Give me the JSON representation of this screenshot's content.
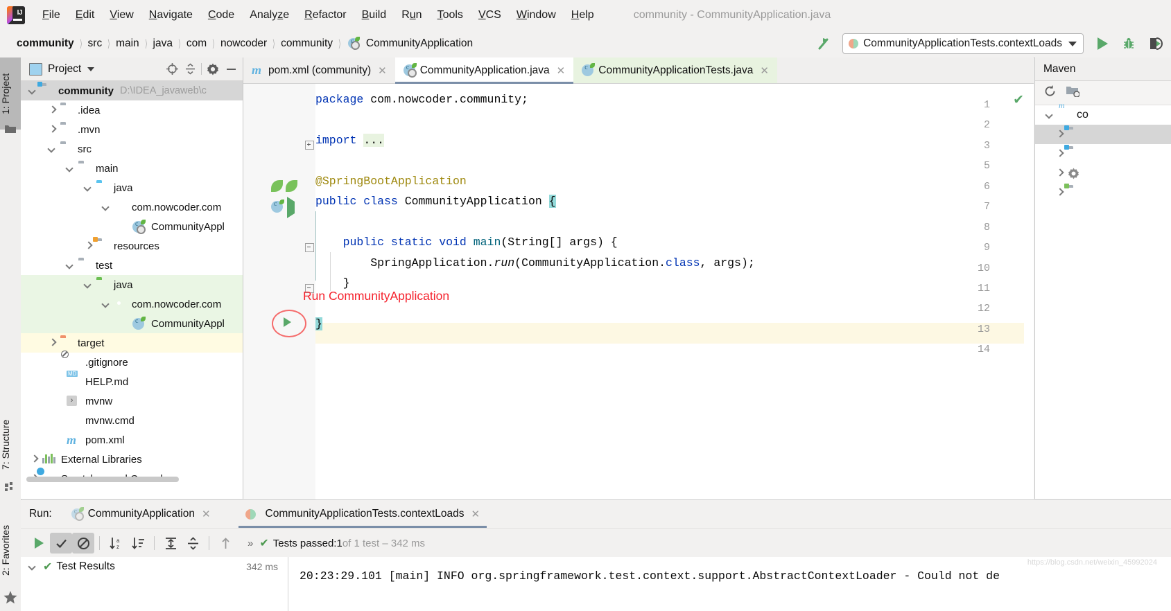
{
  "window": {
    "title": "community - CommunityApplication.java",
    "logo_icon": "intellij-idea-logo"
  },
  "menubar": {
    "items": [
      {
        "label": "File",
        "mnemonic": "F"
      },
      {
        "label": "Edit",
        "mnemonic": "E"
      },
      {
        "label": "View",
        "mnemonic": "V"
      },
      {
        "label": "Navigate",
        "mnemonic": "N"
      },
      {
        "label": "Code",
        "mnemonic": "C"
      },
      {
        "label": "Analyze",
        "mnemonic": "z"
      },
      {
        "label": "Refactor",
        "mnemonic": "R"
      },
      {
        "label": "Build",
        "mnemonic": "B"
      },
      {
        "label": "Run",
        "mnemonic": "R"
      },
      {
        "label": "Tools",
        "mnemonic": "T"
      },
      {
        "label": "VCS",
        "mnemonic": "V"
      },
      {
        "label": "Window",
        "mnemonic": "W"
      },
      {
        "label": "Help",
        "mnemonic": "H"
      }
    ]
  },
  "navbar": {
    "breadcrumbs": [
      {
        "label": "community",
        "bold": true
      },
      {
        "label": "src",
        "bold": false
      },
      {
        "label": "main",
        "bold": false
      },
      {
        "label": "java",
        "bold": false
      },
      {
        "label": "com",
        "bold": false
      },
      {
        "label": "nowcoder",
        "bold": false
      },
      {
        "label": "community",
        "bold": false
      },
      {
        "label": "CommunityApplication",
        "bold": false,
        "icon": "spring-class-icon"
      }
    ],
    "hammer_icon": "build-hammer-icon",
    "run_config": {
      "label": "CommunityApplicationTests.contextLoads",
      "icon": "junit-run-config-icon"
    },
    "buttons": [
      {
        "name": "run-button",
        "icon": "play-icon"
      },
      {
        "name": "debug-button",
        "icon": "bug-icon"
      },
      {
        "name": "run-with-coverage-button",
        "icon": "coverage-icon"
      }
    ]
  },
  "left_rail": {
    "tabs": [
      {
        "label": "1: Project",
        "number": "1",
        "text": ": Project",
        "icon": "project-folder-icon",
        "active": true
      },
      {
        "label": "7: Structure",
        "number": "7",
        "text": ": Structure",
        "icon": "structure-icon",
        "active": false
      },
      {
        "label": "2: Favorites",
        "number": "2",
        "text": ": Favorites",
        "icon": "star-icon",
        "active": false
      }
    ]
  },
  "project_panel": {
    "header": {
      "title": "Project",
      "view_icon": "project-view-icon",
      "caret_icon": "chevron-down-icon",
      "tools": [
        {
          "name": "locate-file-button",
          "icon": "crosshair-icon"
        },
        {
          "name": "collapse-all-button",
          "icon": "collapse-all-icon"
        },
        {
          "name": "settings-button",
          "icon": "gear-icon"
        },
        {
          "name": "hide-button",
          "icon": "minimize-icon"
        }
      ]
    },
    "tree": [
      {
        "label": "community",
        "path": "D:\\IDEA_javaweb\\c",
        "indent": 0,
        "arrow": "down",
        "icon": "module-folder-icon",
        "bold": true,
        "highlight": "selected"
      },
      {
        "label": ".idea",
        "indent": 1,
        "arrow": "right",
        "icon": "folder-icon"
      },
      {
        "label": ".mvn",
        "indent": 1,
        "arrow": "right",
        "icon": "folder-icon"
      },
      {
        "label": "src",
        "indent": 1,
        "arrow": "down",
        "icon": "folder-icon"
      },
      {
        "label": "main",
        "indent": 2,
        "arrow": "down",
        "icon": "folder-icon"
      },
      {
        "label": "java",
        "indent": 3,
        "arrow": "down",
        "icon": "source-folder-blue-icon"
      },
      {
        "label": "com.nowcoder.com",
        "indent": 4,
        "arrow": "down",
        "icon": "package-icon"
      },
      {
        "label": "CommunityAppl",
        "indent": 5,
        "arrow": "none",
        "icon": "spring-boot-class-icon"
      },
      {
        "label": "resources",
        "indent": 3,
        "arrow": "right",
        "icon": "resources-folder-icon"
      },
      {
        "label": "test",
        "indent": 2,
        "arrow": "down",
        "icon": "folder-icon"
      },
      {
        "label": "java",
        "indent": 3,
        "arrow": "down",
        "icon": "test-source-folder-green-icon",
        "highlight": "green"
      },
      {
        "label": "com.nowcoder.com",
        "indent": 4,
        "arrow": "down",
        "icon": "package-icon",
        "highlight": "green"
      },
      {
        "label": "CommunityAppl",
        "indent": 5,
        "arrow": "none",
        "icon": "test-class-icon",
        "highlight": "green"
      },
      {
        "label": "target",
        "indent": 1,
        "arrow": "right",
        "icon": "excluded-folder-orange-icon",
        "highlight": "yellow"
      },
      {
        "label": ".gitignore",
        "indent": 2,
        "arrow": "none",
        "icon": "gitignore-file-icon"
      },
      {
        "label": "HELP.md",
        "indent": 2,
        "arrow": "none",
        "icon": "markdown-file-icon"
      },
      {
        "label": "mvnw",
        "indent": 2,
        "arrow": "none",
        "icon": "shell-script-icon"
      },
      {
        "label": "mvnw.cmd",
        "indent": 2,
        "arrow": "none",
        "icon": "cmd-script-icon"
      },
      {
        "label": "pom.xml",
        "indent": 2,
        "arrow": "none",
        "icon": "maven-pom-icon"
      },
      {
        "label": "External Libraries",
        "indent": 0,
        "arrow": "right",
        "icon": "libraries-icon"
      },
      {
        "label": "Scratches and Consoles",
        "indent": 0,
        "arrow": "right",
        "icon": "scratches-icon"
      }
    ]
  },
  "editor": {
    "tabs": [
      {
        "label": "pom.xml (community)",
        "icon": "maven-pom-icon",
        "active": false,
        "style": "normal"
      },
      {
        "label": "CommunityApplication.java",
        "icon": "spring-boot-class-icon",
        "active": true,
        "style": "active"
      },
      {
        "label": "CommunityApplicationTests.java",
        "icon": "test-class-icon",
        "active": false,
        "style": "green"
      }
    ],
    "close_icon": "close-icon",
    "inspection_status_icon": "inspection-ok-checkmark",
    "line_numbers": [
      "1",
      "2",
      "3",
      "5",
      "6",
      "7",
      "8",
      "9",
      "10",
      "11",
      "12",
      "13",
      "14"
    ],
    "code_lines": [
      {
        "n": "1",
        "segments": [
          {
            "t": "package ",
            "c": "kw"
          },
          {
            "t": "com.nowcoder.community;",
            "c": "txt"
          }
        ]
      },
      {
        "n": "2",
        "segments": []
      },
      {
        "n": "3",
        "segments": [
          {
            "t": "import ",
            "c": "kw"
          },
          {
            "t": "...",
            "c": "import-hl"
          }
        ]
      },
      {
        "n": "5",
        "segments": []
      },
      {
        "n": "6",
        "segments": [
          {
            "t": "@SpringBootApplication",
            "c": "ann"
          }
        ]
      },
      {
        "n": "7",
        "segments": [
          {
            "t": "public class ",
            "c": "kw"
          },
          {
            "t": "CommunityApplication ",
            "c": "cls"
          },
          {
            "t": "{",
            "c": "brace-hl"
          }
        ]
      },
      {
        "n": "8",
        "segments": []
      },
      {
        "n": "9",
        "segments": [
          {
            "t": "    public static void ",
            "c": "kw"
          },
          {
            "t": "main",
            "c": "mth"
          },
          {
            "t": "(String[] args) {",
            "c": "txt"
          }
        ]
      },
      {
        "n": "10",
        "segments": [
          {
            "t": "        SpringApplication.",
            "c": "txt"
          },
          {
            "t": "run",
            "c": "it"
          },
          {
            "t": "(CommunityApplication.",
            "c": "txt"
          },
          {
            "t": "class",
            "c": "kw"
          },
          {
            "t": ", args);",
            "c": "txt"
          }
        ]
      },
      {
        "n": "11",
        "segments": [
          {
            "t": "    }",
            "c": "txt"
          }
        ]
      },
      {
        "n": "12",
        "segments": []
      },
      {
        "n": "13",
        "segments": [
          {
            "t": "}",
            "c": "brace-hl"
          }
        ]
      },
      {
        "n": "14",
        "segments": []
      }
    ],
    "annotation": {
      "text": "Run CommunityApplication",
      "color": "#f5222d"
    },
    "gutter_icons": [
      {
        "line": "6",
        "icons": [
          "spring-bean-search-icon",
          "spring-bean-checked-icon"
        ]
      },
      {
        "line": "7",
        "icons": [
          "spring-boot-icon",
          "run-play-icon"
        ]
      },
      {
        "line": "9",
        "icons": [
          "run-play-circled-icon"
        ]
      }
    ]
  },
  "maven_panel": {
    "title": "Maven",
    "tools": [
      {
        "name": "reload-all-maven-projects-button",
        "icon": "refresh-icon"
      },
      {
        "name": "add-maven-project-button",
        "icon": "folder-add-icon"
      }
    ],
    "tree": [
      {
        "label": "co",
        "icon": "maven-project-icon",
        "arrow": "down",
        "indent": 0
      },
      {
        "label": "",
        "icon": "lifecycle-folder-icon",
        "arrow": "right",
        "indent": 1,
        "selected": true
      },
      {
        "label": "",
        "icon": "plugins-folder-icon",
        "arrow": "right",
        "indent": 1
      },
      {
        "label": "",
        "icon": "gear-icon",
        "arrow": "right",
        "indent": 1
      },
      {
        "label": "",
        "icon": "dependencies-icon",
        "arrow": "right",
        "indent": 1
      }
    ]
  },
  "run_panel": {
    "run_label": "Run:",
    "tabs": [
      {
        "label": "CommunityApplication",
        "icon": "spring-boot-class-icon",
        "active": false
      },
      {
        "label": "CommunityApplicationTests.contextLoads",
        "icon": "junit-run-config-icon",
        "active": true
      }
    ],
    "close_icon": "close-icon",
    "toolbar": [
      {
        "name": "rerun-button",
        "icon": "play-icon",
        "pressed": false
      },
      {
        "name": "show-passed-button",
        "icon": "checkmark-icon",
        "pressed": true
      },
      {
        "name": "show-ignored-button",
        "icon": "ignored-circle-icon",
        "pressed": true
      },
      {
        "name": "sort-alphabetically-button",
        "icon": "sort-az-icon",
        "pressed": false
      },
      {
        "name": "sort-by-duration-button",
        "icon": "sort-duration-icon",
        "pressed": false
      },
      {
        "name": "expand-all-button",
        "icon": "expand-all-icon",
        "pressed": false
      },
      {
        "name": "collapse-all-button",
        "icon": "collapse-all-icon",
        "pressed": false
      },
      {
        "name": "previous-failed-test-button",
        "icon": "arrow-up-icon",
        "pressed": false
      }
    ],
    "status": {
      "chevrons": "»",
      "check_icon": "green-check-icon",
      "prefix": "Tests passed: ",
      "count": "1",
      "suffix": " of 1 test – 342 ms"
    },
    "test_tree": [
      {
        "label": "Test Results",
        "time": "342 ms",
        "icon": "green-check-icon",
        "arrow": "down"
      }
    ],
    "console": {
      "lines": [
        "20:23:29.101 [main] INFO org.springframework.test.context.support.AbstractContextLoader - Could not de"
      ],
      "watermark": "https://blog.csdn.net/weixin_45992024"
    }
  },
  "colors": {
    "accent_blue": "#7a8ea8",
    "keyword_blue": "#0033b3",
    "annotation_gold": "#9e880d",
    "green_run": "#59a869",
    "red_annotation": "#f5222d",
    "brace_highlight": "#93d9d9",
    "cursor_line": "#fdf8e3",
    "test_source_green": "#eaf6e4",
    "excluded_yellow": "#fffbe2"
  }
}
